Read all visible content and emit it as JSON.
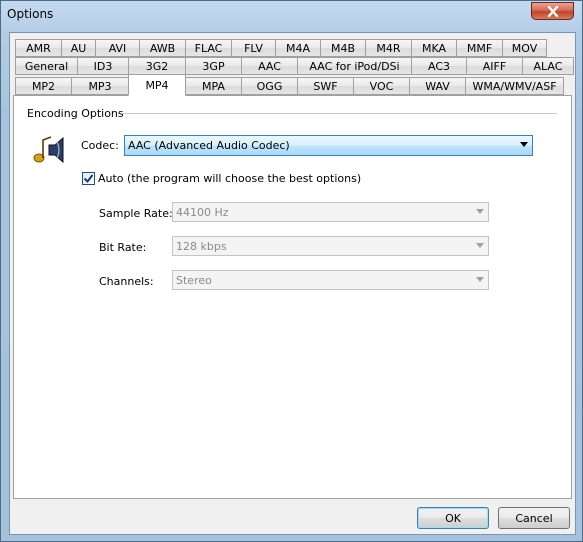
{
  "window": {
    "title": "Options"
  },
  "tabs": {
    "row1": [
      "AMR",
      "AU",
      "AVI",
      "AWB",
      "FLAC",
      "FLV",
      "M4A",
      "M4B",
      "M4R",
      "MKA",
      "MMF",
      "MOV"
    ],
    "row2": [
      "General",
      "ID3",
      "3G2",
      "3GP",
      "AAC",
      "AAC for iPod/DSi",
      "AC3",
      "AIFF",
      "ALAC"
    ],
    "row3": [
      "MP2",
      "MP3",
      "MP4",
      "MPA",
      "OGG",
      "SWF",
      "VOC",
      "WAV",
      "WMA/WMV/ASF"
    ],
    "selected": "MP4"
  },
  "encoding": {
    "group_label": "Encoding Options",
    "codec_label": "Codec:",
    "codec_value": "AAC (Advanced Audio Codec)",
    "auto_label": "Auto (the program will choose the best options)",
    "auto_checked": true,
    "sample_rate_label": "Sample Rate:",
    "sample_rate_value": "44100 Hz",
    "bit_rate_label": "Bit Rate:",
    "bit_rate_value": "128 kbps",
    "channels_label": "Channels:",
    "channels_value": "Stereo"
  },
  "buttons": {
    "ok": "OK",
    "cancel": "Cancel"
  },
  "icons": {
    "close": "close-icon",
    "speaker": "speaker-icon",
    "check": "check-icon",
    "dropdown": "chevron-down-icon"
  }
}
